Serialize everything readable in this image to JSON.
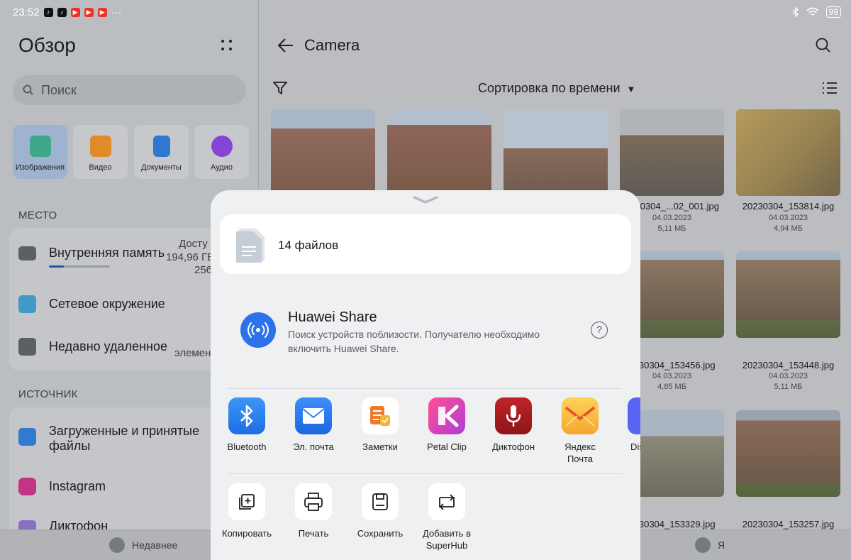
{
  "status_bar": {
    "time": "23:52",
    "battery": "99"
  },
  "left": {
    "title": "Обзор",
    "search_placeholder": "Поиск",
    "categories": [
      {
        "label": "Изображения",
        "icon": "image-icon",
        "color": "#2fa882"
      },
      {
        "label": "Видео",
        "icon": "video-icon",
        "color": "#ef8a22"
      },
      {
        "label": "Документы",
        "icon": "document-icon",
        "color": "#2f7fe0"
      },
      {
        "label": "Аудио",
        "icon": "audio-icon",
        "color": "#8c3ff0"
      }
    ],
    "section_place": "МЕСТО",
    "internal_memory": {
      "label": "Внутренняя память",
      "available": "Досту",
      "size": "194,96 ГБ",
      "total": "256"
    },
    "network": {
      "label": "Сетевое окружение"
    },
    "recently_deleted": {
      "label": "Недавно удаленное",
      "count": "элемен"
    },
    "section_source": "ИСТОЧНИК",
    "downloads": {
      "label": "Загруженные и принятые файлы"
    },
    "instagram": {
      "label": "Instagram"
    },
    "dictaphone": {
      "label": "Диктофон"
    }
  },
  "right": {
    "title": "Camera",
    "sort_label": "Сортировка по времени",
    "files": [
      {
        "name": "0230304_...02_001.jpg",
        "date": "04.03.2023",
        "size": "5,11 МБ"
      },
      {
        "name": "20230304_153814.jpg",
        "date": "04.03.2023",
        "size": "4,94 МБ"
      },
      {
        "name": "0230304_153456.jpg",
        "date": "04.03.2023",
        "size": "4,85 МБ"
      },
      {
        "name": "20230304_153448.jpg",
        "date": "04.03.2023",
        "size": "5,11 МБ"
      },
      {
        "name": "0230304_153329.jpg"
      },
      {
        "name": "20230304_153257.jpg"
      }
    ]
  },
  "bottom_nav": {
    "recent": "Недавнее",
    "me": "Я"
  },
  "share_sheet": {
    "file_count": "14 файлов",
    "huawei_share": {
      "title": "Huawei Share",
      "description": "Поиск устройств поблизости. Получателю необходимо включить Huawei Share."
    },
    "apps": [
      {
        "label": "Bluetooth",
        "icon": "bluetooth-icon",
        "color": "#2f86f0"
      },
      {
        "label": "Эл. почта",
        "icon": "mail-icon",
        "color": "#2b7ff2"
      },
      {
        "label": "Заметки",
        "icon": "notes-icon",
        "color": "#ffffff"
      },
      {
        "label": "Petal Clip",
        "icon": "petal-clip-icon",
        "color": "#e6307f"
      },
      {
        "label": "Диктофон",
        "icon": "microphone-icon",
        "color": "#a41a1c"
      },
      {
        "label": "Яндекс Почта",
        "icon": "yandex-mail-icon",
        "color": "#f7bb39"
      },
      {
        "label": "Dis",
        "icon": "discord-icon",
        "color": "#5865f2"
      }
    ],
    "actions": [
      {
        "label": "Копировать",
        "icon": "copy-icon"
      },
      {
        "label": "Печать",
        "icon": "print-icon"
      },
      {
        "label": "Сохранить",
        "icon": "save-icon"
      },
      {
        "label": "Добавить в SuperHub",
        "icon": "superhub-icon"
      }
    ]
  }
}
